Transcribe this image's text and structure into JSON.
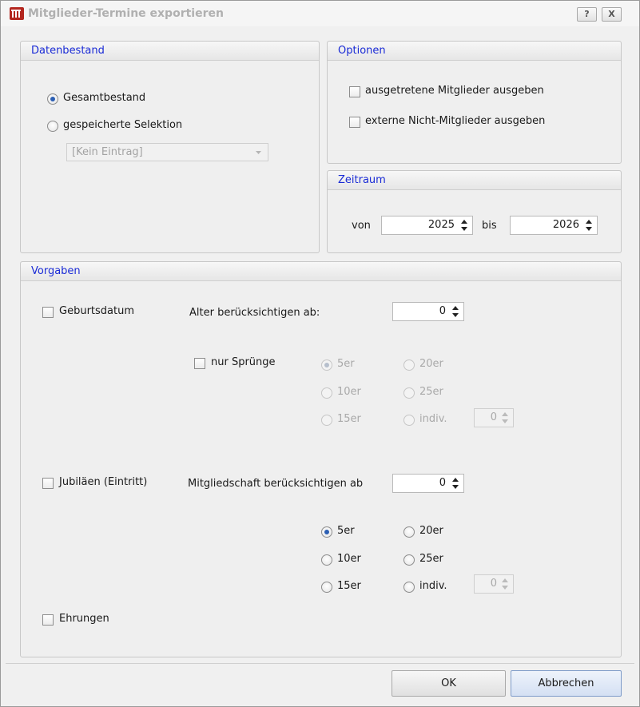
{
  "window": {
    "title": "Mitglieder-Termine exportieren",
    "help_btn": "?",
    "close_btn": "X"
  },
  "datenbestand": {
    "title": "Datenbestand",
    "option_gesamt": "Gesamtbestand",
    "option_selektion": "gespeicherte Selektion",
    "selected": "Gesamtbestand",
    "combo_value": "[Kein Eintrag]"
  },
  "optionen": {
    "title": "Optionen",
    "ausgetretene": "ausgetretene Mitglieder ausgeben",
    "externe": "externe Nicht-Mitglieder ausgeben"
  },
  "zeitraum": {
    "title": "Zeitraum",
    "von_label": "von",
    "von_value": "2025",
    "bis_label": "bis",
    "bis_value": "2026"
  },
  "vorgaben": {
    "title": "Vorgaben",
    "geburtsdatum": {
      "checkbox_label": "Geburtsdatum",
      "alter_label": "Alter berücksichtigen ab:",
      "alter_value": "0",
      "nur_spruenge_label": "nur Sprünge",
      "steps": [
        "5er",
        "10er",
        "15er",
        "20er",
        "25er",
        "indiv."
      ],
      "selected_step": "5er",
      "indiv_value": "0"
    },
    "jubilaeen": {
      "checkbox_label": "Jubiläen (Eintritt)",
      "mitgliedschaft_label": "Mitgliedschaft berücksichtigen ab",
      "mitgliedschaft_value": "0",
      "steps": [
        "5er",
        "10er",
        "15er",
        "20er",
        "25er",
        "indiv."
      ],
      "selected_step": "5er",
      "indiv_value": "0"
    },
    "ehrungen_label": "Ehrungen"
  },
  "footer": {
    "ok_label": "OK",
    "cancel_label": "Abbrechen"
  },
  "colors": {
    "group_title": "#1a2bd6",
    "app_icon": "#b3261e",
    "radio_dot": "#2c5fb3"
  }
}
